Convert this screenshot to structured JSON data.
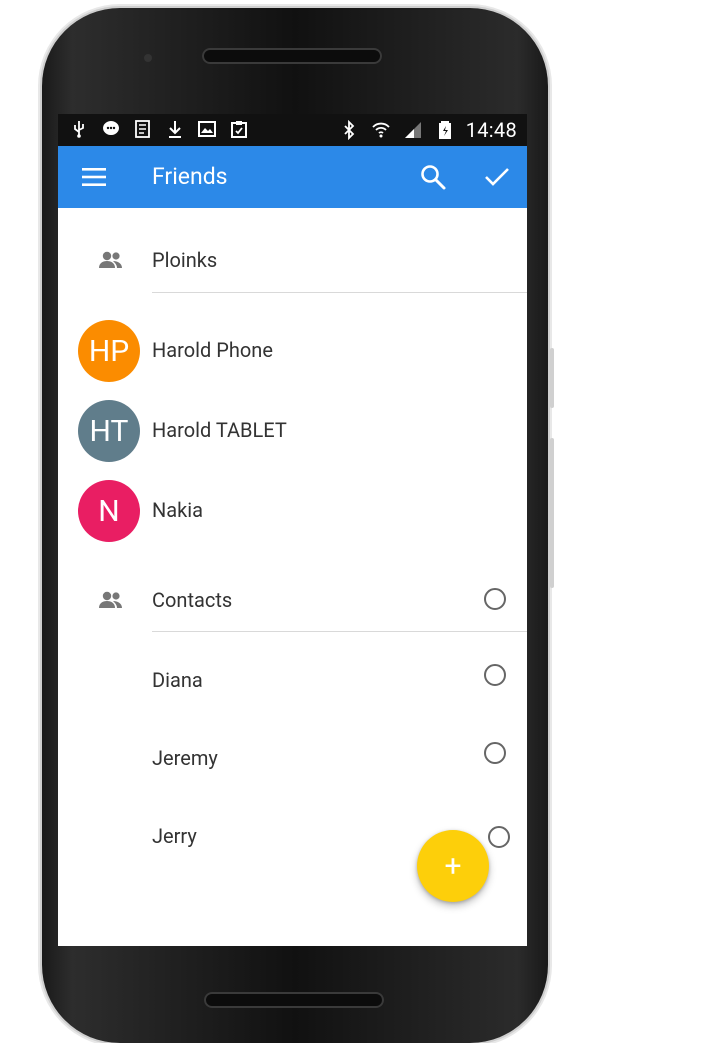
{
  "status_bar": {
    "time": "14:48",
    "left_icons": [
      "usb-icon",
      "chat-bubble-icon",
      "sim-card-icon",
      "download-icon",
      "image-icon",
      "clipboard-icon"
    ],
    "right_icons": [
      "bluetooth-icon",
      "wifi-icon",
      "signal-icon",
      "battery-icon"
    ]
  },
  "appbar": {
    "title": "Friends",
    "background": "#2c89e8"
  },
  "groups": [
    {
      "label": "Ploinks",
      "friends": [
        {
          "initials": "HP",
          "name": "Harold Phone",
          "color": "#fb8c00"
        },
        {
          "initials": "HT",
          "name": "Harold TABLET",
          "color": "#607d8b"
        },
        {
          "initials": "N",
          "name": "Nakia",
          "color": "#e91e63"
        }
      ]
    },
    {
      "label": "Contacts",
      "contacts": [
        {
          "name": "Diana"
        },
        {
          "name": "Jeremy"
        },
        {
          "name": "Jerry"
        }
      ]
    }
  ],
  "fab": {
    "label": "+",
    "color": "#fdcf0a"
  }
}
